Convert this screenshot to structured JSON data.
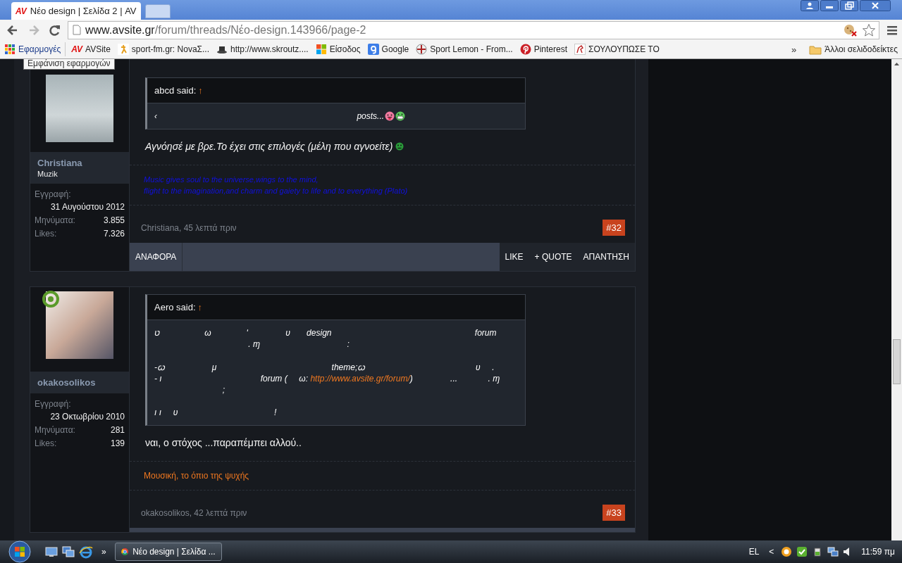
{
  "browser": {
    "tabs": [
      {
        "logo": "AV",
        "title": "Νέο design | Σελίδα 2 | AV",
        "selected": true
      }
    ],
    "address": {
      "host": "www.avsite.gr",
      "path": "/forum/threads/Νέο-design.143966/page-2"
    },
    "bookmarks": [
      {
        "label": "Εφαρμογές",
        "kind": "apps"
      },
      {
        "label": "AVSite",
        "kind": "av",
        "logo": "AV"
      },
      {
        "label": "sport-fm.gr: NovaΣ...",
        "kind": "runner"
      },
      {
        "label": "http://www.skroutz....",
        "kind": "hat"
      },
      {
        "label": "Είσοδος",
        "kind": "windows"
      },
      {
        "label": "Google",
        "kind": "google"
      },
      {
        "label": "Sport Lemon - From...",
        "kind": "crest"
      },
      {
        "label": "Pinterest",
        "kind": "pinterest"
      },
      {
        "label": "ΣΟΥΛΟΥΠΩΣΕ ΤΟ",
        "kind": "horse"
      }
    ],
    "overflow": "»",
    "other_bookmarks": "Άλλοι σελιδοδείκτες",
    "tooltip": "Εμφάνιση εφαρμογών"
  },
  "posts": [
    {
      "author": "Christiana",
      "user_title": "Muzik",
      "online": false,
      "stats": [
        {
          "label": "Εγγραφή:",
          "value": "31 Αυγούστου 2012",
          "wide": true
        },
        {
          "label": "Μηνύματα:",
          "value": "3.855",
          "wide": false
        },
        {
          "label": "Likes:",
          "value": "7.326",
          "wide": false
        }
      ],
      "quote": {
        "author": "abcd said:",
        "arrow": "↑",
        "lines": [
          [
            {
              "kind": "text",
              "text": "‹                                                                                     posts..."
            },
            {
              "kind": "smiley"
            }
          ]
        ]
      },
      "message": "Αγνόησέ με βρε.Το έχει στις επιλογές (μέλη που αγνοείτε)",
      "italic": true,
      "smiley": true,
      "signature": {
        "color": "#1010e0",
        "lines": [
          "Music gives soul to the universe,wings to the mind,",
          "flight to the imagination,and charm and gaiety to life and to everything (Plato)"
        ]
      },
      "byline": "Christiana, 45 λεπτά πριν",
      "number": "#32",
      "actions_left": [
        "ΑΝΑΦΟΡΑ"
      ],
      "actions_right": [
        "LIKE",
        "+ QUOTE",
        "ΑΠΑΝΤΗΣΗ"
      ]
    },
    {
      "author": "okakosolikos",
      "online": true,
      "stats": [
        {
          "label": "Εγγραφή:",
          "value": "23 Οκτωβρίου 2010",
          "wide": true
        },
        {
          "label": "Μηνύματα:",
          "value": "281",
          "wide": false
        },
        {
          "label": "Likes:",
          "value": "139",
          "wide": false
        }
      ],
      "quote": {
        "author": "Aero said:",
        "arrow": "↑",
        "lines": [
          [
            {
              "kind": "text",
              "text": "ט                   ω               ʹ                υ       design                                                             forum"
            }
          ],
          [
            {
              "kind": "text",
              "text": "                                        . ɱ                                     :"
            }
          ],
          [
            {
              "kind": "break"
            }
          ],
          [
            {
              "kind": "text",
              "text": "-ꞷ                    μ                                                 theme;ꞷ                                               υ     ."
            }
          ],
          [
            {
              "kind": "text",
              "text": "- ı                                          forum (     ω: "
            },
            {
              "kind": "link",
              "text": "http://www.avsite.gr/forum/"
            },
            {
              "kind": "text",
              "text": ")                ...             . ɱ"
            }
          ],
          [
            {
              "kind": "text",
              "text": "                             ;"
            }
          ],
          [
            {
              "kind": "break"
            }
          ],
          [
            {
              "kind": "text",
              "text": "ı ı     υ                                         !"
            }
          ]
        ]
      },
      "message": "ναι, ο στόχος ...παραπέμπει αλλού..",
      "italic": false,
      "smiley": false,
      "signature": {
        "color": "#f07820",
        "lines": [
          "Μουσική, το όπιο της ψυχής"
        ]
      },
      "byline": "okakosolikos, 42 λεπτά πριν",
      "number": "#33"
    }
  ],
  "taskbar": {
    "task": "Νέο design | Σελίδα ...",
    "overflow": "»",
    "language": "EL",
    "tray_arrow": "<",
    "time": "11:59 πμ"
  }
}
